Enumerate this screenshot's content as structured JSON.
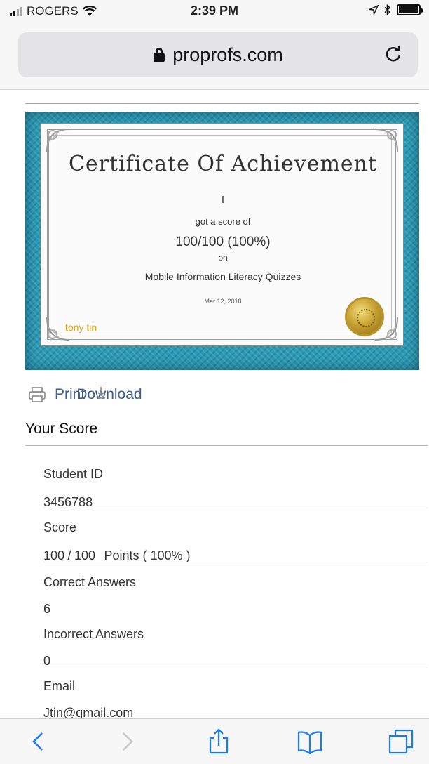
{
  "status_bar": {
    "carrier": "ROGERS",
    "time": "2:39 PM"
  },
  "browser": {
    "url": "proprofs.com"
  },
  "certificate": {
    "title": "Certificate Of Achievement",
    "name": "I",
    "got_text": "got a score of",
    "score": "100/100 (100%)",
    "on_text": "on",
    "quiz": "Mobile Information Literacy Quizzes",
    "date": "Mar 12, 2018",
    "signature": "tony tin"
  },
  "actions": {
    "print_label": "Print",
    "download_label": "Download"
  },
  "score_section": {
    "heading": "Your Score",
    "student_id_label": "Student ID",
    "student_id_value": "3456788",
    "score_label": "Score",
    "score_earned": "100",
    "score_slash": "/",
    "score_total": "100",
    "score_suffix": "Points ( 100% )",
    "correct_label": "Correct Answers",
    "correct_value": "6",
    "incorrect_label": "Incorrect Answers",
    "incorrect_value": "0",
    "email_label": "Email",
    "email_value": "Jtin@gmail.com"
  },
  "icons": {
    "wifi": "wifi-icon",
    "location": "location-arrow-icon",
    "bluetooth": "bluetooth-icon",
    "battery": "battery-icon",
    "lock": "lock-icon",
    "reload": "reload-icon",
    "print": "printer-icon",
    "download": "download-icon",
    "back": "back-chevron-icon",
    "forward": "forward-chevron-icon",
    "share": "share-icon",
    "bookmarks": "bookmarks-icon",
    "tabs": "tabs-icon"
  },
  "colors": {
    "link": "#3d5d8c",
    "ios_blue": "#1a7cf5",
    "frame": "#2a9bb5",
    "signature": "#e8a21a",
    "slash": "#3a9a3a"
  }
}
